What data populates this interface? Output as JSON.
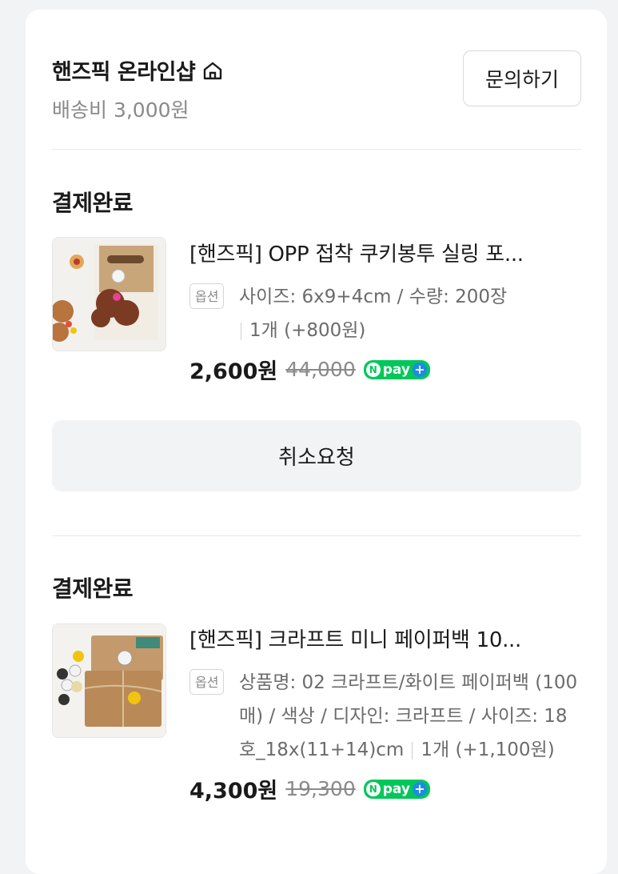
{
  "shop": {
    "name": "핸즈픽 온라인샵",
    "icon": "home-icon",
    "shipping": "배송비 3,000원",
    "inquiry_label": "문의하기"
  },
  "orders": [
    {
      "status": "결제완료",
      "title": "[핸즈픽] OPP 접착 쿠키봉투 실링 포...",
      "option_badge": "옵션",
      "option_text": "사이즈: 6x9+4cm / 수량: 200장",
      "quantity": "1개 (+800원)",
      "price": "2,600원",
      "original_price": "44,000",
      "npay": "pay",
      "cancel_label": "취소요청"
    },
    {
      "status": "결제완료",
      "title": "[핸즈픽] 크라프트 미니 페이퍼백 10...",
      "option_badge": "옵션",
      "option_text": "상품명: 02 크라프트/화이트 페이퍼백 (100매) / 색상 / 디자인: 크라프트 / 사이즈: 18호_18x(11+14)cm",
      "quantity": "1개 (+1,100원)",
      "price": "4,300원",
      "original_price": "19,300",
      "npay": "pay"
    }
  ],
  "colors": {
    "npay_green": "#03c75a",
    "npay_plus_blue": "#1e8ae6",
    "button_bg": "#f2f3f5"
  }
}
